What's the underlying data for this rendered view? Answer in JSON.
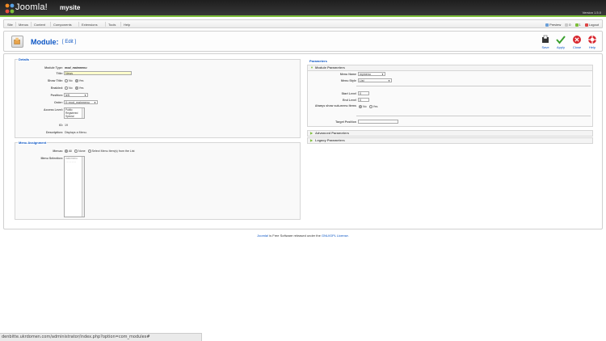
{
  "header": {
    "logo_text": "Joomla!",
    "site_name": "mysite",
    "version": "Version 1.5.0"
  },
  "menubar": {
    "items": [
      "Site",
      "Menus",
      "Content",
      "Components",
      "Extensions",
      "Tools",
      "Help"
    ],
    "status": {
      "preview": "Preview",
      "messages": "0",
      "users": "1",
      "logout": "Logout"
    }
  },
  "toolbar": {
    "title": "Module:",
    "subtitle": "[ Edit ]",
    "buttons": [
      "Save",
      "Apply",
      "Close",
      "Help"
    ]
  },
  "details": {
    "legend": "Details",
    "module_type_label": "Module Type:",
    "module_type_value": "mod_mainmenu",
    "title_label": "Title:",
    "title_value": "News",
    "show_title_label": "Show Title:",
    "no": "No",
    "yes": "Yes",
    "enabled_label": "Enabled:",
    "position_label": "Position:",
    "position_value": "left",
    "order_label": "Order:",
    "order_value": "0::mod_mainmenu",
    "access_label": "Access Level:",
    "access_options": [
      "Public",
      "Registered",
      "Special"
    ],
    "id_label": "ID:",
    "id_value": "19",
    "description_label": "Description:",
    "description_value": "Displays a Menu."
  },
  "menu_assignment": {
    "legend": "Menu Assignment",
    "menus_label": "Menus:",
    "all": "All",
    "none": "None",
    "select": "Select Menu Item(s) from the List",
    "selection_label": "Menu Selection:",
    "selection_items": [
      "mainmenu",
      "- - - - - - -"
    ]
  },
  "parameters": {
    "legend": "Parameters",
    "module_params_title": "Module Parameters",
    "menu_name_label": "Menu Name",
    "menu_name_value": "mymenu",
    "menu_style_label": "Menu Style",
    "menu_style_value": "List",
    "start_level_label": "Start Level",
    "start_level_value": "0",
    "end_level_label": "End Level",
    "end_level_value": "0",
    "always_show_label": "Always show sub-menu Items",
    "no": "No",
    "yes": "Yes",
    "target_position_label": "Target Position",
    "advanced": "Advanced Parameters",
    "legacy": "Legacy Parameters"
  },
  "footer": {
    "joomla_link": "Joomla!",
    "text_mid": " is Free Software released under the ",
    "license_link": "GNU/GPL License."
  },
  "statusbar": {
    "url": "denbitte.ukrdomen.com/administrator/index.php?option=com_modules#"
  },
  "colors": {
    "accent": "#0b55c4",
    "brand_green": "#7dbe3a",
    "header_dark": "#2a2a2a"
  }
}
